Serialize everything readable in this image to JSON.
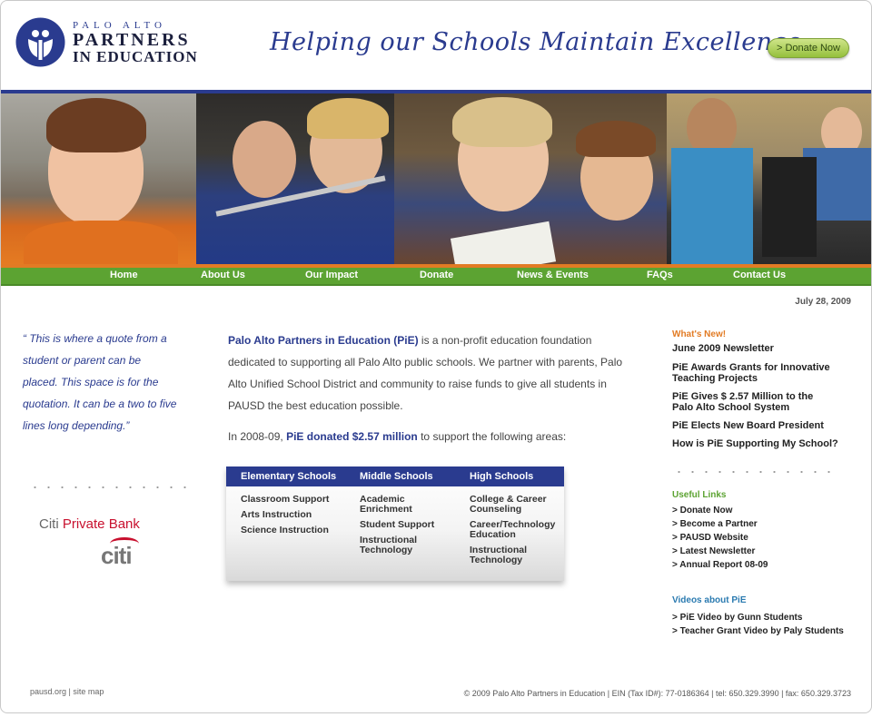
{
  "header": {
    "logo": {
      "line1": "PALO ALTO",
      "line2": "PARTNERS",
      "line3": "IN EDUCATION"
    },
    "tagline": "Helping our Schools Maintain Excellence",
    "donate_button": "> Donate Now"
  },
  "nav": {
    "items": [
      "Home",
      "About Us",
      "Our Impact",
      "Donate",
      "News & Events",
      "FAQs",
      "Contact Us"
    ]
  },
  "date": "July 28, 2009",
  "quote": "“ This is where a quote from a student or parent can be placed. This space is for the quotation. It can be a two to five lines long depending.”",
  "sponsor": {
    "label_a": "Citi",
    "label_b": "Private Bank",
    "logo": "citi"
  },
  "main": {
    "org_name": "Palo Alto Partners in Education (PiE)",
    "intro_rest": " is a non-profit education foundation dedicated to supporting all Palo Alto public schools. We partner with parents, Palo Alto Unified School District and community to raise funds to give all students in PAUSD the best education possible.",
    "donation_pre": "In 2008-09, ",
    "donation_amount": "PiE donated $2.57 million",
    "donation_post": " to support the following areas:"
  },
  "table": {
    "columns": [
      {
        "header": "Elementary Schools",
        "items": [
          "Classroom Support",
          "Arts Instruction",
          "Science Instruction"
        ]
      },
      {
        "header": "Middle Schools",
        "items": [
          "Academic Enrichment",
          "Student Support",
          "Instructional Technology"
        ]
      },
      {
        "header": "High Schools",
        "items": [
          "College & Career Counseling",
          "Career/Technology Education",
          "Instructional Technology"
        ]
      }
    ]
  },
  "sidebar": {
    "whats_new_title": "What's New!",
    "news": [
      "June 2009 Newsletter",
      "PiE Awards Grants for Innovative Teaching Projects",
      "PiE Gives $ 2.57 Million to the Palo Alto School System",
      "PiE Elects New Board President",
      "How is PiE Supporting My School?"
    ],
    "useful_links_title": "Useful Links",
    "useful_links": [
      "> Donate Now",
      "> Become a Partner",
      "> PAUSD Website",
      "> Latest Newsletter",
      "> Annual Report 08-09"
    ],
    "videos_title": "Videos about PiE",
    "videos": [
      "> PiE Video by Gunn Students",
      "> Teacher Grant Video by Paly Students"
    ]
  },
  "footer": {
    "left": "pausd.org | site map",
    "right": "© 2009 Palo Alto Partners in Education | EIN (Tax ID#): 77-0186364 | tel: 650.329.3990 | fax: 650.329.3723"
  },
  "colors": {
    "brand_blue": "#2a3b8f",
    "nav_green": "#5ca332",
    "accent_orange": "#e27b24",
    "links_green": "#5ca332",
    "videos_blue": "#2a7ab0"
  }
}
